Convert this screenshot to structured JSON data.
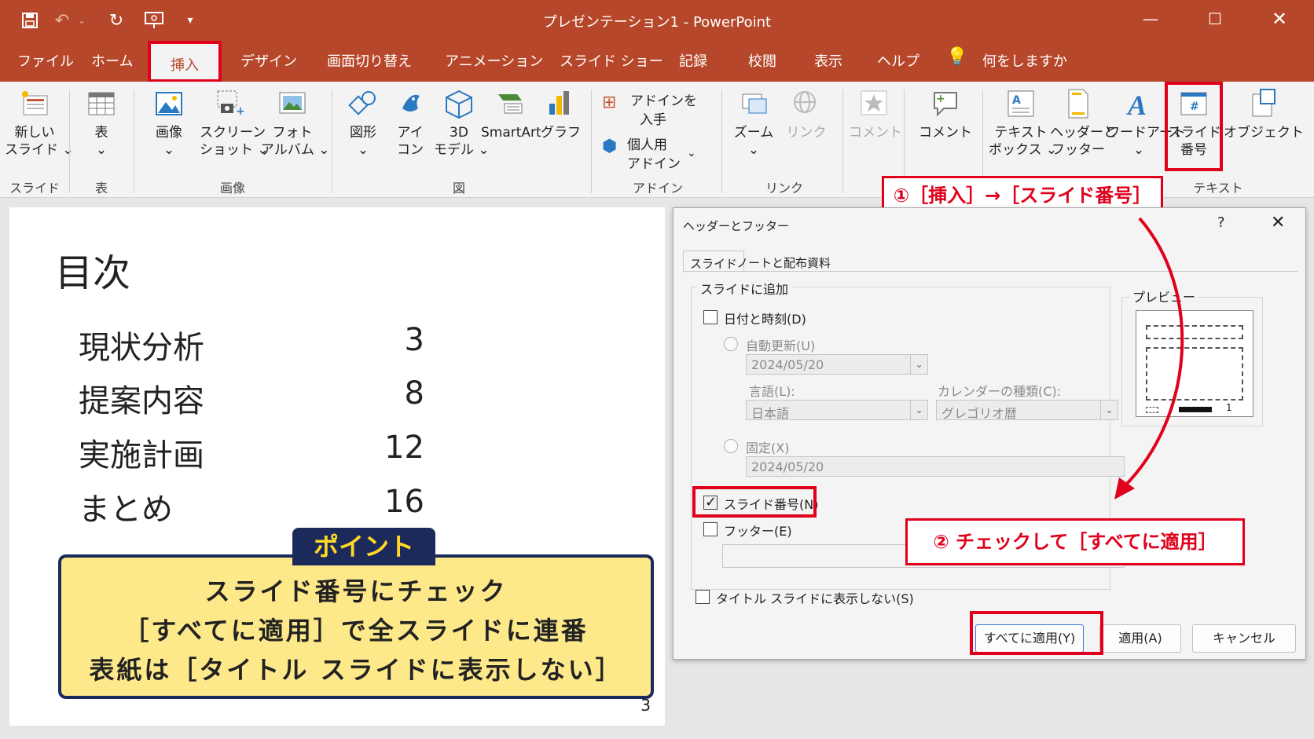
{
  "app": {
    "title": "プレゼンテーション1 - PowerPoint",
    "tabs": [
      "ファイル",
      "ホーム",
      "挿入",
      "デザイン",
      "画面切り替え",
      "アニメーション",
      "スライド ショー",
      "記録",
      "校閲",
      "表示",
      "ヘルプ"
    ],
    "tell_me": "何をしますか",
    "active_tab": "挿入",
    "accent_color": "#b7472a",
    "highlight_color": "#e0001b"
  },
  "ribbon": {
    "buttons": {
      "new_slide_1": "新しい",
      "new_slide_2": "スライド ⌄",
      "table": "表",
      "image": "画像",
      "screenshot_1": "スクリーン",
      "screenshot_2": "ショット ⌄",
      "photo_album_1": "フォト",
      "photo_album_2": "アルバム ⌄",
      "shapes": "図形",
      "icons_1": "アイ",
      "icons_2": "コン",
      "model3d_1": "3D",
      "model3d_2": "モデル ⌄",
      "smartart": "SmartArt",
      "chart": "グラフ",
      "get_addins_1": "アドインを",
      "get_addins_2": "入手",
      "my_addins_1": "個人用",
      "my_addins_2": "アドイン",
      "zoom": "ズーム",
      "link": "リンク",
      "comment_disabled": "コメント",
      "comment": "コメント",
      "textbox_1": "テキスト",
      "textbox_2": "ボックス ⌄",
      "header_footer_1": "ヘッダーと",
      "header_footer_2": "フッター",
      "wordart": "ワードアート",
      "slide_number_1": "スライド",
      "slide_number_2": "番号",
      "object": "オブジェクト"
    },
    "groups": {
      "slides": "スライド",
      "tables": "表",
      "images": "画像",
      "illustrations": "図",
      "addins": "アドイン",
      "links": "リンク",
      "text": "テキスト"
    }
  },
  "slide": {
    "title": "目次",
    "toc": [
      {
        "label": "現状分析",
        "page": "3"
      },
      {
        "label": "提案内容",
        "page": "8"
      },
      {
        "label": "実施計画",
        "page": "12"
      },
      {
        "label": "まとめ",
        "page": "16"
      }
    ],
    "point_tag": "ポイント",
    "point_lines": [
      "スライド番号にチェック",
      "［すべてに適用］で全スライドに連番",
      "表紙は［タイトル スライドに表示しない］"
    ],
    "page_number": "3"
  },
  "dialog": {
    "title": "ヘッダーとフッター",
    "help": "?",
    "close": "✕",
    "tabs": [
      "スライド",
      "ノートと配布資料"
    ],
    "group_label": "スライドに追加",
    "date_time": "日付と時刻(D)",
    "auto_update": "自動更新(U)",
    "auto_update_value": "2024/05/20",
    "language_label": "言語(L):",
    "language_value": "日本語",
    "calendar_label": "カレンダーの種類(C):",
    "calendar_value": "グレゴリオ暦",
    "fixed": "固定(X)",
    "fixed_value": "2024/05/20",
    "slide_number": "スライド番号(N)",
    "slide_number_checked": true,
    "footer": "フッター(E)",
    "footer_value": "",
    "no_title_slide": "タイトル スライドに表示しない(S)",
    "preview_label": "プレビュー",
    "preview_number": "1",
    "apply_all": "すべてに適用(Y)",
    "apply": "適用(A)",
    "cancel": "キャンセル"
  },
  "annotations": {
    "step1": "①［挿入］→［スライド番号］",
    "step2": "② チェックして［すべてに適用］"
  }
}
